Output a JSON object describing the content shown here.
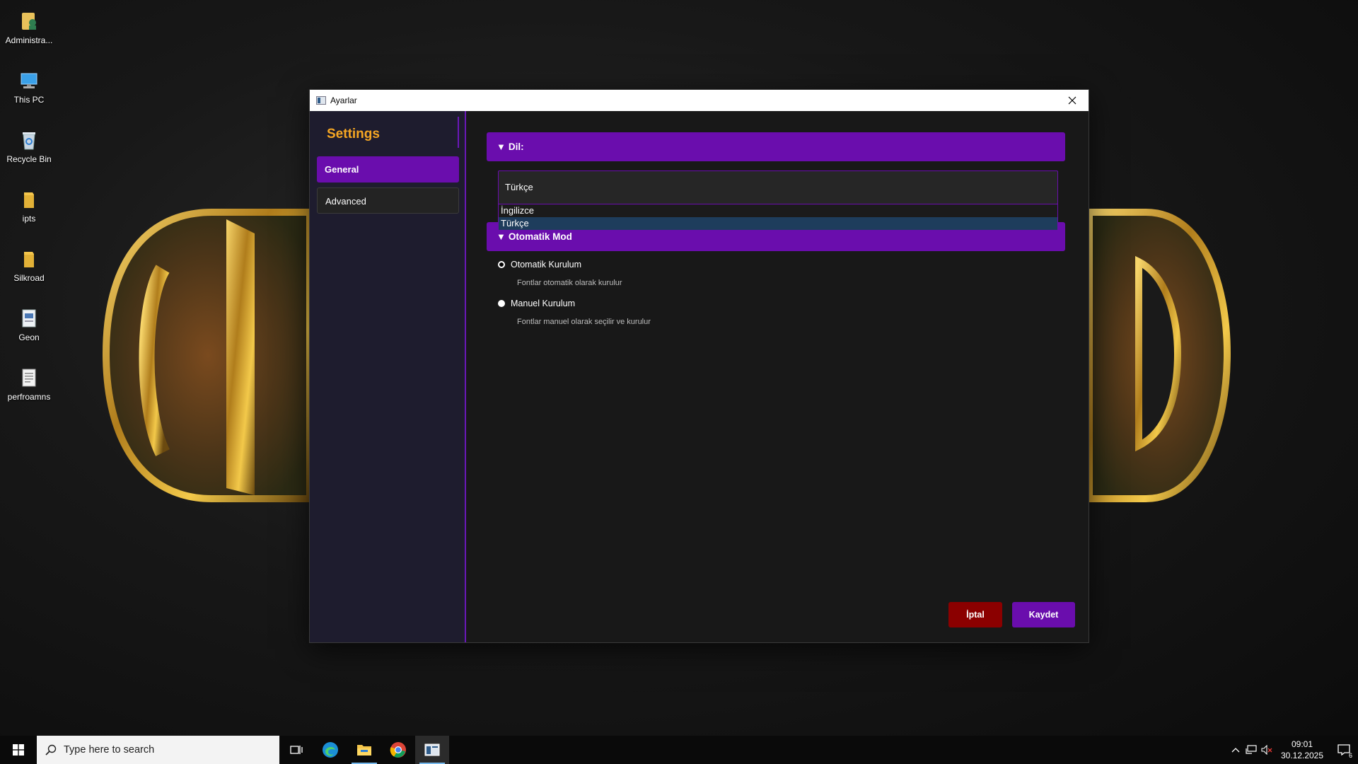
{
  "desktop": {
    "icons": [
      {
        "label": "Administra...",
        "icon": "user-folder-icon"
      },
      {
        "label": "This PC",
        "icon": "computer-icon"
      },
      {
        "label": "Recycle Bin",
        "icon": "recycle-bin-icon"
      },
      {
        "label": "ipts",
        "icon": "folder-icon"
      },
      {
        "label": "Silkroad",
        "icon": "folder-icon"
      },
      {
        "label": "Geon",
        "icon": "document-icon"
      },
      {
        "label": "perfroamns",
        "icon": "text-file-icon"
      }
    ]
  },
  "window": {
    "title": "Ayarlar",
    "sidebar": {
      "title": "Settings",
      "items": [
        {
          "label": "General",
          "active": true
        },
        {
          "label": "Advanced",
          "active": false
        }
      ]
    },
    "language_section": {
      "header": "Dil:",
      "selected": "Türkçe",
      "options": [
        "İngilizce",
        "Türkçe"
      ]
    },
    "mode_section": {
      "header": "Otomatik Mod",
      "options": [
        {
          "label": "Otomatik Kurulum",
          "description": "Fontlar otomatik olarak kurulur",
          "checked": true
        },
        {
          "label": "Manuel Kurulum",
          "description": "Fontlar manuel olarak seçilir ve kurulur",
          "checked": false
        }
      ]
    },
    "buttons": {
      "cancel": "İptal",
      "save": "Kaydet"
    }
  },
  "taskbar": {
    "search_placeholder": "Type here to search",
    "time": "09:01",
    "date": "30.12.2025",
    "notification_count": "6"
  },
  "colors": {
    "accent": "#6a0dad",
    "settings_title": "#f5a623",
    "cancel": "#8b0000",
    "sidebar_bg": "#1e1c2e"
  }
}
